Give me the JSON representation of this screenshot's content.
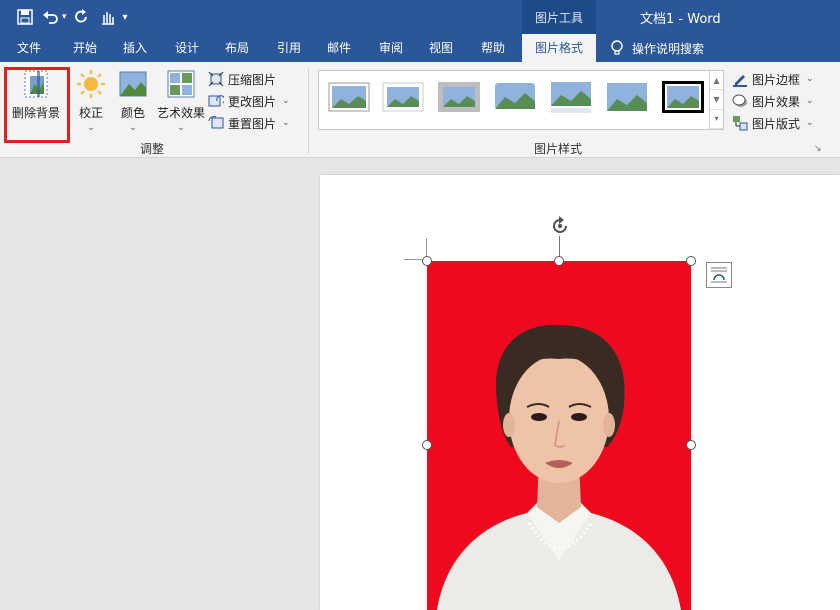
{
  "qat": {
    "save_icon": "save-icon",
    "undo_icon": "undo-icon",
    "redo_icon": "redo-icon",
    "touch_icon": "touch-mode-icon",
    "customize_icon": "customize-qat-icon"
  },
  "titlebar": {
    "tools_label": "图片工具",
    "doc_title": "文档1  -  Word"
  },
  "tabs": [
    "文件",
    "开始",
    "插入",
    "设计",
    "布局",
    "引用",
    "邮件",
    "审阅",
    "视图",
    "帮助",
    "图片格式"
  ],
  "active_tab": "图片格式",
  "tell_me": "操作说明搜索",
  "adjust": {
    "remove_bg": "删除背景",
    "corrections": "校正",
    "color": "颜色",
    "artistic": "艺术效果",
    "compress": "压缩图片",
    "change": "更改图片",
    "reset": "重置图片",
    "group_label": "调整"
  },
  "styles": {
    "group_label": "图片样式",
    "border": "图片边框",
    "effects": "图片效果",
    "layout": "图片版式"
  },
  "colors": {
    "accent": "#2b579a",
    "photo_bg": "#ee0a1e",
    "highlight": "#e02020"
  }
}
